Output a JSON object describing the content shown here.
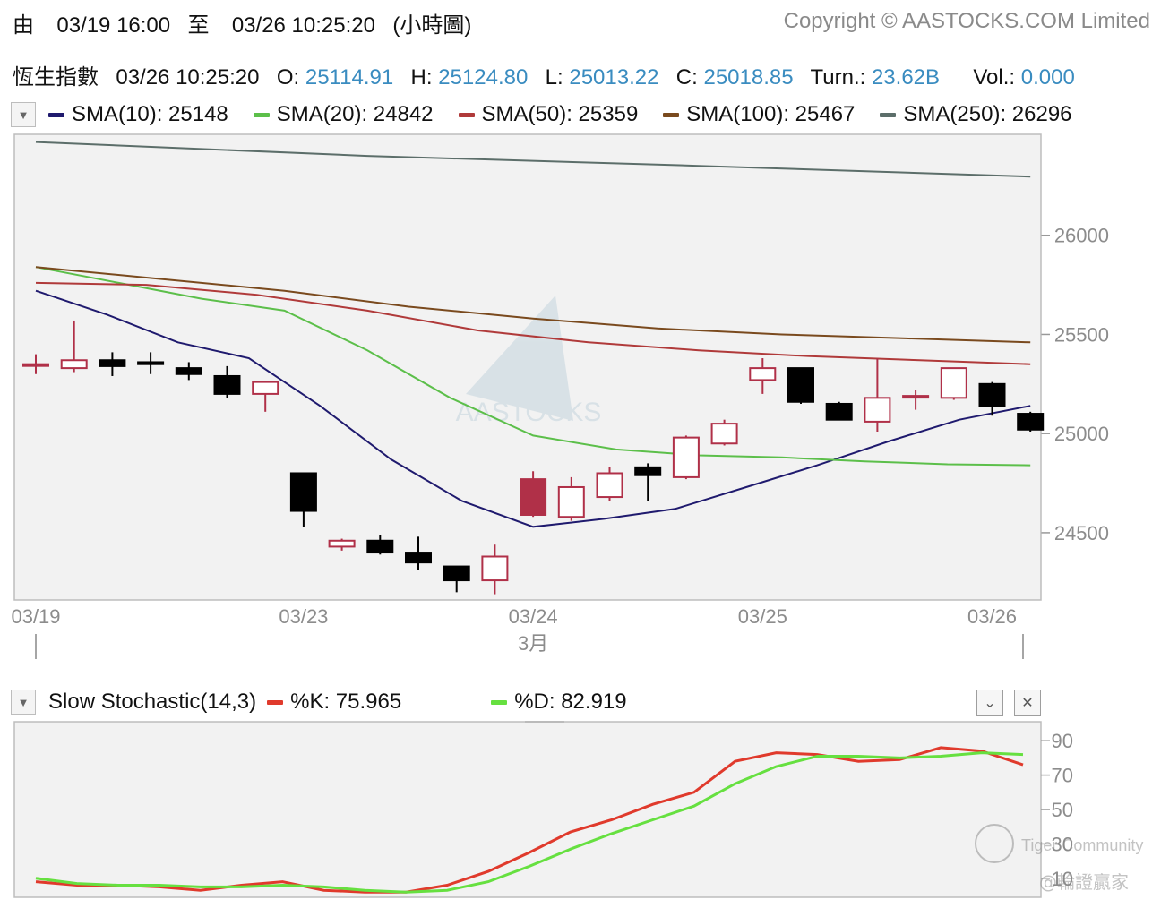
{
  "header": {
    "from_label": "由",
    "from_time": "03/19 16:00",
    "to_label": "至",
    "to_time": "03/26 10:25:20",
    "mode": "(小時圖)",
    "copyright": "Copyright © AASTOCKS.COM Limited"
  },
  "quote": {
    "name": "恆生指數",
    "time": "03/26 10:25:20",
    "o_label": "O:",
    "o": "25114.91",
    "h_label": "H:",
    "h": "25124.80",
    "l_label": "L:",
    "l": "25013.22",
    "c_label": "C:",
    "c": "25018.85",
    "turn_label": "Turn.:",
    "turn": "23.62B",
    "vol_label": "Vol.:",
    "vol": "0.000"
  },
  "sma_legend": [
    {
      "label": "SMA(10): 25148",
      "color": "#1f1a6e"
    },
    {
      "label": "SMA(20): 24842",
      "color": "#5cbf4a"
    },
    {
      "label": "SMA(50): 25359",
      "color": "#b03a3a"
    },
    {
      "label": "SMA(100): 25467",
      "color": "#7a4a1e"
    },
    {
      "label": "SMA(250): 26296",
      "color": "#5c6e6a"
    }
  ],
  "stoch_legend": {
    "title": "Slow Stochastic(14,3)",
    "k_label": "%K: 75.965",
    "k_color": "#e03a2c",
    "d_label": "%D: 82.919",
    "d_color": "#66e040"
  },
  "watermark": {
    "brand": "AASTOCKS",
    "community": "Tiger Community",
    "handle": "@輪證贏家"
  },
  "colors": {
    "up": "#b03048",
    "down": "#000000",
    "k": "#e03a2c",
    "d": "#66e040",
    "grid": "#cfcfcf"
  },
  "chart_data": [
    {
      "type": "candlestick",
      "title": "恆生指數",
      "x_tick_labels": [
        "03/19",
        "03/23",
        "03/24",
        "03/25",
        "03/26"
      ],
      "x_tick_index": [
        0,
        7,
        13,
        19,
        25
      ],
      "month_label": "3月",
      "y_ticks": [
        24500,
        25000,
        25500,
        26000
      ],
      "ylim": [
        24170,
        26500
      ],
      "ohlc": [
        {
          "o": 25350,
          "h": 25400,
          "l": 25300,
          "c": 25350
        },
        {
          "o": 25330,
          "h": 25570,
          "l": 25310,
          "c": 25370
        },
        {
          "o": 25370,
          "h": 25410,
          "l": 25290,
          "c": 25340
        },
        {
          "o": 25360,
          "h": 25410,
          "l": 25300,
          "c": 25350
        },
        {
          "o": 25330,
          "h": 25360,
          "l": 25270,
          "c": 25300
        },
        {
          "o": 25290,
          "h": 25340,
          "l": 25180,
          "c": 25200
        },
        {
          "o": 25200,
          "h": 25260,
          "l": 25110,
          "c": 25260
        },
        {
          "o": 24800,
          "h": 24800,
          "l": 24530,
          "c": 24610
        },
        {
          "o": 24430,
          "h": 24470,
          "l": 24410,
          "c": 24460
        },
        {
          "o": 24460,
          "h": 24490,
          "l": 24390,
          "c": 24400
        },
        {
          "o": 24400,
          "h": 24480,
          "l": 24310,
          "c": 24350
        },
        {
          "o": 24330,
          "h": 24330,
          "l": 24200,
          "c": 24260
        },
        {
          "o": 24260,
          "h": 24440,
          "l": 24190,
          "c": 24380
        },
        {
          "o": 24590,
          "h": 24810,
          "l": 24580,
          "c": 24770
        },
        {
          "o": 24580,
          "h": 24780,
          "l": 24560,
          "c": 24730
        },
        {
          "o": 24680,
          "h": 24830,
          "l": 24660,
          "c": 24800
        },
        {
          "o": 24830,
          "h": 24850,
          "l": 24660,
          "c": 24790
        },
        {
          "o": 24780,
          "h": 24990,
          "l": 24770,
          "c": 24980
        },
        {
          "o": 24950,
          "h": 25070,
          "l": 24940,
          "c": 25050
        },
        {
          "o": 25270,
          "h": 25380,
          "l": 25200,
          "c": 25330
        },
        {
          "o": 25330,
          "h": 25330,
          "l": 25150,
          "c": 25160
        },
        {
          "o": 25150,
          "h": 25160,
          "l": 25070,
          "c": 25070
        },
        {
          "o": 25060,
          "h": 25380,
          "l": 25010,
          "c": 25180
        },
        {
          "o": 25190,
          "h": 25220,
          "l": 25120,
          "c": 25190
        },
        {
          "o": 25180,
          "h": 25330,
          "l": 25170,
          "c": 25330
        },
        {
          "o": 25250,
          "h": 25260,
          "l": 25090,
          "c": 25140
        },
        {
          "o": 25100,
          "h": 25110,
          "l": 25010,
          "c": 25020
        }
      ],
      "series": [
        {
          "name": "SMA(10)",
          "values": [
            25720,
            25600,
            25460,
            25380,
            25140,
            24870,
            24660,
            24530,
            24570,
            24620,
            24730,
            24840,
            24960,
            25070,
            25140
          ]
        },
        {
          "name": "SMA(20)",
          "values": [
            25840,
            25760,
            25680,
            25620,
            25420,
            25180,
            24990,
            24920,
            24890,
            24880,
            24860,
            24845,
            24840
          ]
        },
        {
          "name": "SMA(50)",
          "values": [
            25760,
            25750,
            25700,
            25620,
            25520,
            25460,
            25420,
            25390,
            25370,
            25350
          ]
        },
        {
          "name": "SMA(100)",
          "values": [
            25840,
            25780,
            25720,
            25640,
            25580,
            25530,
            25500,
            25480,
            25460
          ]
        },
        {
          "name": "SMA(250)",
          "values": [
            26470,
            26400,
            26350,
            26296
          ]
        }
      ]
    },
    {
      "type": "line",
      "title": "Slow Stochastic(14,3)",
      "y_ticks": [
        10,
        30,
        50,
        70,
        90
      ],
      "ylim": [
        0,
        100
      ],
      "series": [
        {
          "name": "%K",
          "values": [
            8,
            6,
            6,
            5,
            3,
            6,
            8,
            3,
            2,
            2,
            6,
            14,
            25,
            37,
            44,
            53,
            60,
            78,
            83,
            82,
            78,
            79,
            86,
            84,
            76
          ]
        },
        {
          "name": "%D",
          "values": [
            10,
            7,
            6,
            6,
            5,
            5,
            6,
            5,
            3,
            2,
            3,
            8,
            17,
            27,
            36,
            44,
            52,
            65,
            75,
            81,
            81,
            80,
            81,
            83,
            82
          ]
        }
      ]
    }
  ]
}
